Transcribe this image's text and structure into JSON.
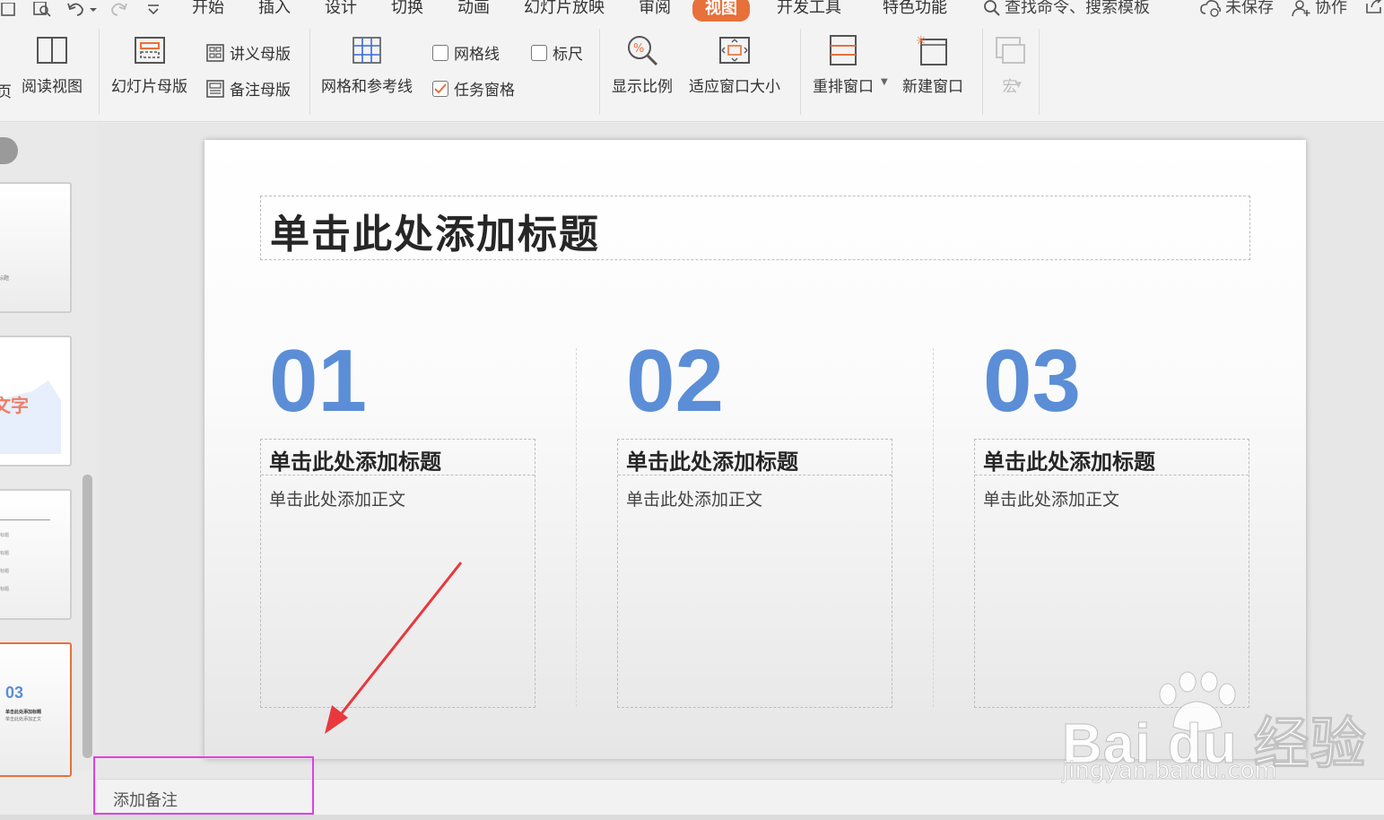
{
  "menu": {
    "tabs": [
      "开始",
      "插入",
      "设计",
      "切换",
      "动画",
      "幻灯片放映",
      "审阅",
      "视图",
      "开发工具",
      "特色功能"
    ],
    "active_tab": "视图",
    "search": "查找命令、搜索模板",
    "unsaved": "未保存",
    "collab": "协作"
  },
  "ribbon": {
    "page_partial": "页",
    "reading_view": "阅读视图",
    "slide_master": "幻灯片母版",
    "handout_master": "讲义母版",
    "notes_master": "备注母版",
    "grid_guides": "网格和参考线",
    "gridlines": "网格线",
    "ruler": "标尺",
    "task_pane": "任务窗格",
    "zoom": "显示比例",
    "fit_window": "适应窗口大小",
    "arrange": "重排窗口",
    "new_window": "新建窗口",
    "macro": "宏"
  },
  "thumbnails": {
    "t1_caption": "标题",
    "t2_text": "文字",
    "t3_lines": [
      "标题",
      "标题",
      "标题",
      "标题"
    ],
    "t4_num": "03",
    "t4_title": "单击此处添加标题",
    "t4_body": "单击此处添加正文"
  },
  "slide": {
    "title": "单击此处添加标题",
    "columns": [
      {
        "num": "01",
        "heading": "单击此处添加标题",
        "body": "单击此处添加正文"
      },
      {
        "num": "02",
        "heading": "单击此处添加标题",
        "body": "单击此处添加正文"
      },
      {
        "num": "03",
        "heading": "单击此处添加标题",
        "body": "单击此处添加正文"
      }
    ]
  },
  "notes": {
    "placeholder": "添加备注"
  },
  "watermark": {
    "brand": "Bai du 经验",
    "site": "jingyan.baidu.com"
  },
  "colors": {
    "accent": "#e8703a",
    "number_blue": "#5b8ed6",
    "highlight": "#e23ee6",
    "arrow": "#e8383d"
  }
}
